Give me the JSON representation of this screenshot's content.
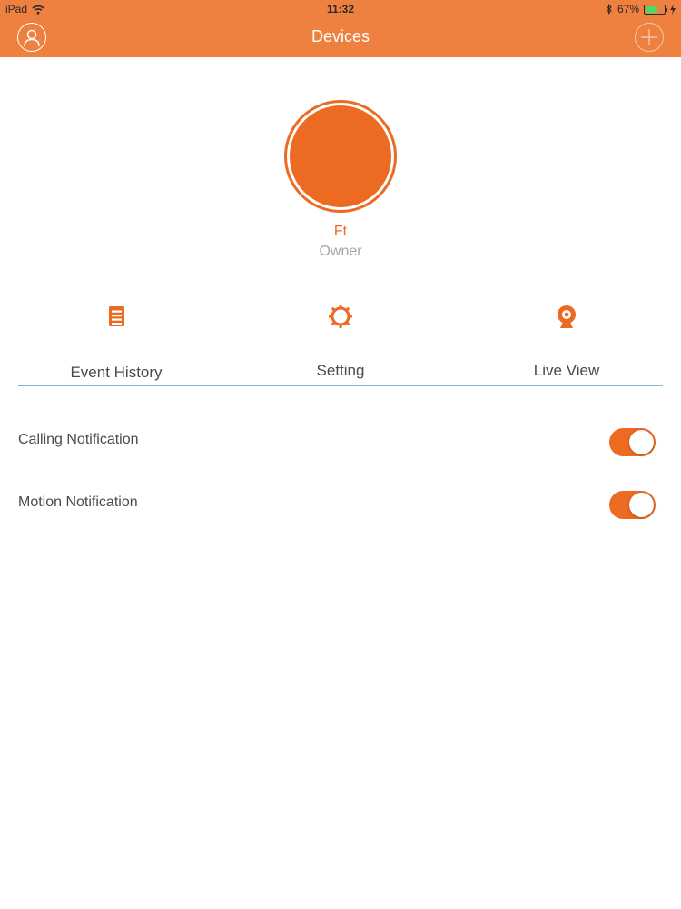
{
  "status_bar": {
    "device": "iPad",
    "time": "11:32",
    "battery": "67%",
    "battery_level": 0.67,
    "icons": [
      "wifi-icon",
      "bluetooth-icon",
      "battery-icon",
      "charging-icon"
    ]
  },
  "nav": {
    "title": "Devices",
    "left_icon": "user-profile-icon",
    "right_icon": "add-icon"
  },
  "colors": {
    "accent": "#ec6a22",
    "navbar": "#ee8040",
    "divider": "#7ab8d8"
  },
  "device": {
    "name": "Ft",
    "role": "Owner"
  },
  "tabs": [
    {
      "label": "Event History",
      "icon": "event-history-icon"
    },
    {
      "label": "Setting",
      "icon": "settings-gear-icon"
    },
    {
      "label": "Live View",
      "icon": "camera-icon"
    }
  ],
  "notifications": [
    {
      "label": "Calling Notification",
      "enabled": true
    },
    {
      "label": "Motion Notification",
      "enabled": true
    }
  ]
}
